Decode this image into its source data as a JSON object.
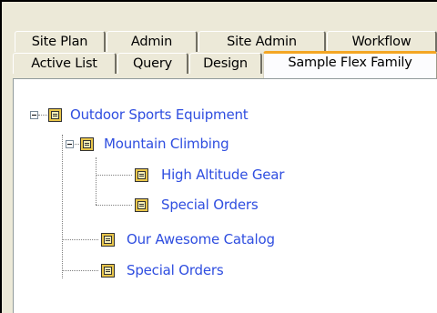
{
  "tabs_row1": [
    "Site Plan",
    "Admin",
    "Site Admin",
    "Workflow"
  ],
  "tabs_row2": [
    "Active List",
    "Query",
    "Design",
    "Sample Flex Family"
  ],
  "active_tab": "Sample Flex Family",
  "tree": {
    "root": {
      "label": "Outdoor Sports Equipment",
      "expanded": true,
      "children": [
        {
          "label": "Mountain Climbing",
          "expanded": true,
          "children": [
            {
              "label": "High Altitude Gear"
            },
            {
              "label": "Special Orders"
            }
          ]
        },
        {
          "label": "Our Awesome Catalog"
        },
        {
          "label": "Special Orders"
        }
      ]
    }
  },
  "colors": {
    "link": "#2f4ee0",
    "active_tab_accent": "#f4a623",
    "window_bg": "#ece9d8"
  },
  "icons": {
    "expander": "minus-box-icon",
    "node": "flex-family-icon"
  }
}
